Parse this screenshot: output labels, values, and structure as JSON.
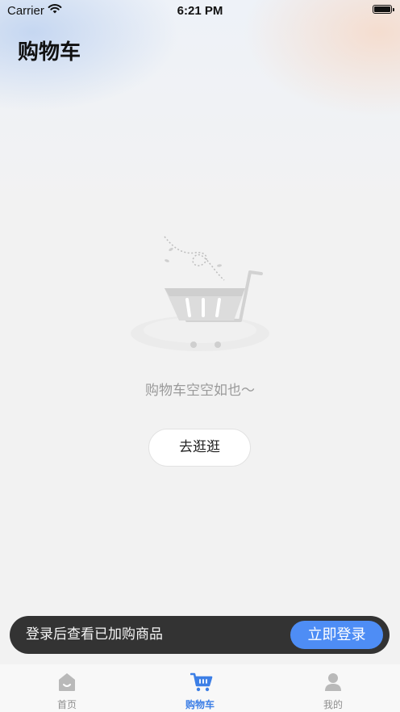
{
  "status_bar": {
    "carrier": "Carrier",
    "time": "6:21 PM"
  },
  "header": {
    "title": "购物车"
  },
  "empty_state": {
    "message": "购物车空空如也～",
    "action_label": "去逛逛"
  },
  "login_prompt": {
    "text": "登录后查看已加购商品",
    "button_label": "立即登录"
  },
  "tab_bar": {
    "tabs": [
      {
        "label": "首页",
        "icon": "home-icon",
        "active": false
      },
      {
        "label": "购物车",
        "icon": "cart-icon",
        "active": true
      },
      {
        "label": "我的",
        "icon": "profile-icon",
        "active": false
      }
    ]
  },
  "colors": {
    "accent": "#4e8df5",
    "tab_active": "#3d7fe6",
    "login_bar_bg": "#333333",
    "background": "#f2f2f2"
  }
}
